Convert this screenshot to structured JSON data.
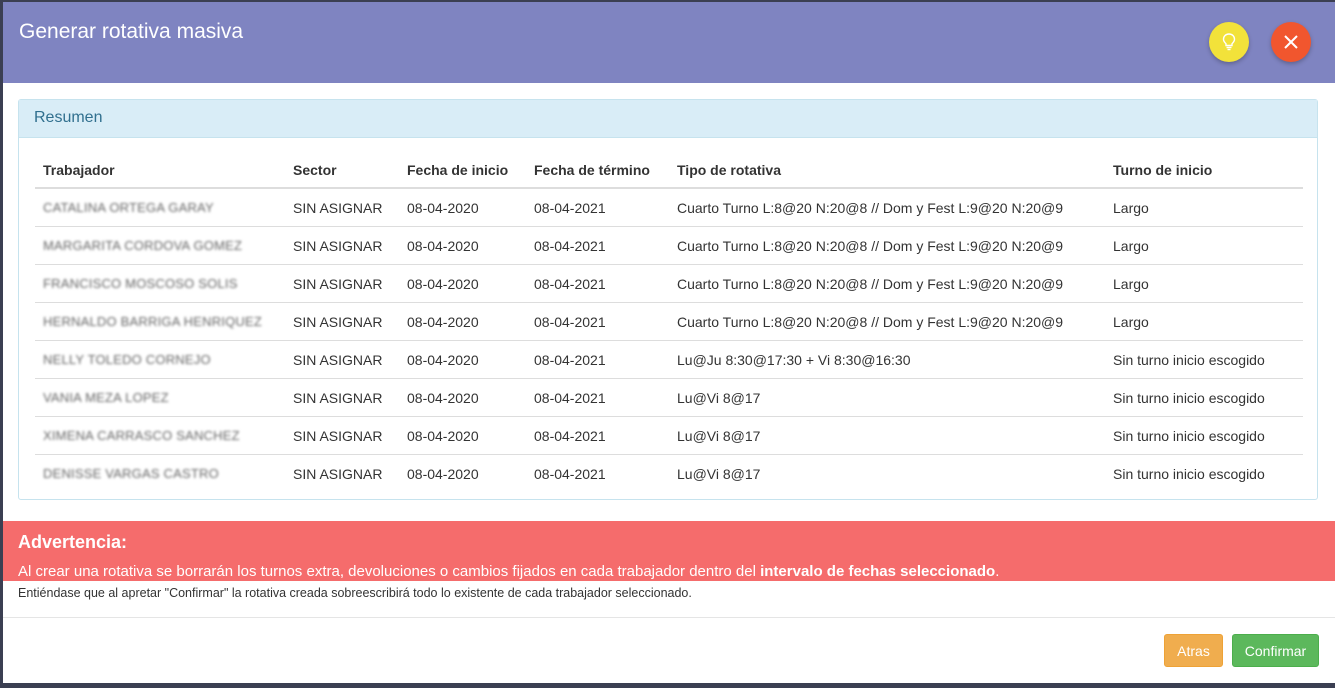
{
  "modal": {
    "title": "Generar rotativa masiva",
    "hint_icon": "lightbulb-icon",
    "close_icon": "close-icon",
    "colors": {
      "header": "#7f84c1",
      "hint": "#f2e23a",
      "close": "#f1562e"
    }
  },
  "summary": {
    "title": "Resumen",
    "columns": [
      "Trabajador",
      "Sector",
      "Fecha de inicio",
      "Fecha de término",
      "Tipo de rotativa",
      "Turno de inicio"
    ],
    "rows": [
      [
        "CATALINA ORTEGA GARAY",
        "SIN ASIGNAR",
        "08-04-2020",
        "08-04-2021",
        "Cuarto Turno L:8@20 N:20@8 // Dom y Fest L:9@20 N:20@9",
        "Largo"
      ],
      [
        "MARGARITA CORDOVA GOMEZ",
        "SIN ASIGNAR",
        "08-04-2020",
        "08-04-2021",
        "Cuarto Turno L:8@20 N:20@8 // Dom y Fest L:9@20 N:20@9",
        "Largo"
      ],
      [
        "FRANCISCO MOSCOSO SOLIS",
        "SIN ASIGNAR",
        "08-04-2020",
        "08-04-2021",
        "Cuarto Turno L:8@20 N:20@8 // Dom y Fest L:9@20 N:20@9",
        "Largo"
      ],
      [
        "HERNALDO BARRIGA HENRIQUEZ",
        "SIN ASIGNAR",
        "08-04-2020",
        "08-04-2021",
        "Cuarto Turno L:8@20 N:20@8 // Dom y Fest L:9@20 N:20@9",
        "Largo"
      ],
      [
        "NELLY TOLEDO CORNEJO",
        "SIN ASIGNAR",
        "08-04-2020",
        "08-04-2021",
        "Lu@Ju 8:30@17:30 + Vi 8:30@16:30",
        "Sin turno inicio escogido"
      ],
      [
        "VANIA MEZA LOPEZ",
        "SIN ASIGNAR",
        "08-04-2020",
        "08-04-2021",
        "Lu@Vi 8@17",
        "Sin turno inicio escogido"
      ],
      [
        "XIMENA CARRASCO SANCHEZ",
        "SIN ASIGNAR",
        "08-04-2020",
        "08-04-2021",
        "Lu@Vi 8@17",
        "Sin turno inicio escogido"
      ],
      [
        "DENISSE VARGAS CASTRO",
        "SIN ASIGNAR",
        "08-04-2020",
        "08-04-2021",
        "Lu@Vi 8@17",
        "Sin turno inicio escogido"
      ]
    ]
  },
  "warning": {
    "title": "Advertencia:",
    "text_before": "Al crear una rotativa se borrarán los turnos extra, devoluciones o cambios fijados en cada trabajador dentro del ",
    "text_bold": "intervalo de fechas seleccionado",
    "text_after": ".",
    "note": "Entiéndase que al apretar \"Confirmar\" la rotativa creada sobreescribirá todo lo existente de cada trabajador seleccionado.",
    "color": "#f56c6c"
  },
  "footer": {
    "back_label": "Atras",
    "confirm_label": "Confirmar",
    "back_color": "#f0ad4e",
    "confirm_color": "#5cb85c"
  }
}
